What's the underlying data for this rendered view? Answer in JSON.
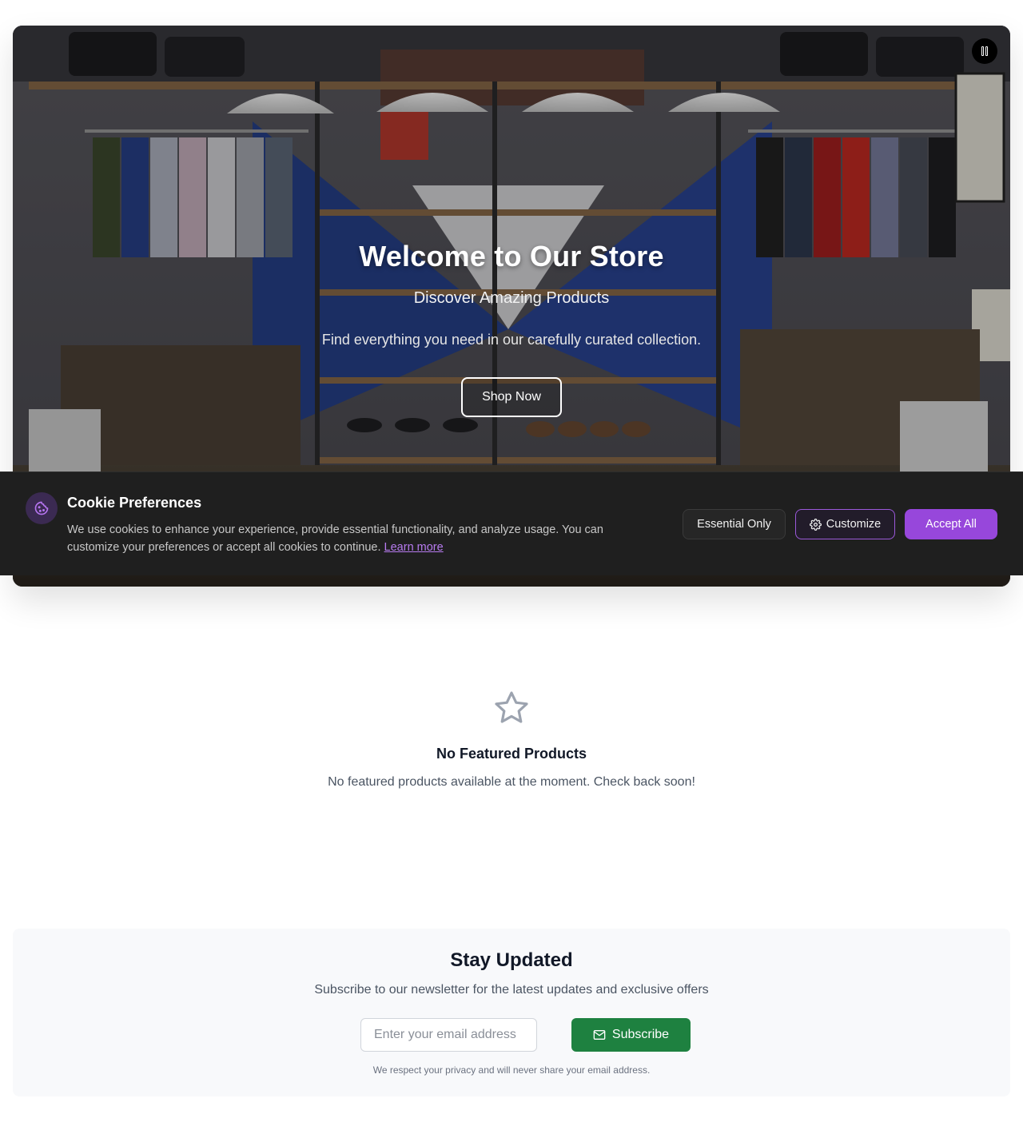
{
  "hero": {
    "title": "Welcome to Our Store",
    "subtitle": "Discover Amazing Products",
    "description": "Find everything you need in our carefully curated collection.",
    "cta_label": "Shop Now",
    "pause_icon": "pause-icon"
  },
  "cookie_banner": {
    "icon": "cookie-icon",
    "title": "Cookie Preferences",
    "text": "We use cookies to enhance your experience, provide essential functionality, and analyze usage. You can customize your preferences or accept all cookies to continue.",
    "learn_more": "Learn more",
    "buttons": {
      "essential": "Essential Only",
      "customize": "Customize",
      "accept": "Accept All"
    },
    "accent_color": "#9747db"
  },
  "featured": {
    "icon": "star-icon",
    "title": "No Featured Products",
    "message": "No featured products available at the moment. Check back soon!"
  },
  "newsletter": {
    "title": "Stay Updated",
    "subtitle": "Subscribe to our newsletter for the latest updates and exclusive offers",
    "email_placeholder": "Enter your email address",
    "subscribe_label": "Subscribe",
    "privacy_note": "We respect your privacy and will never share your email address.",
    "button_color": "#1e8140"
  }
}
